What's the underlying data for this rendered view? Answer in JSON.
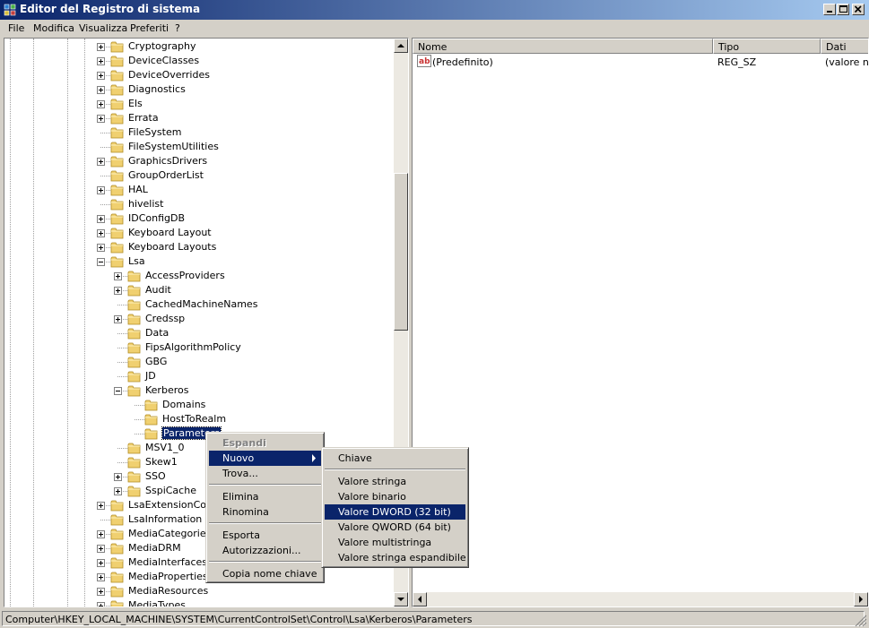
{
  "window": {
    "title": "Editor del Registro di sistema"
  },
  "menubar": {
    "items": [
      "File",
      "Modifica",
      "Visualizza",
      "Preferiti",
      "?"
    ]
  },
  "tree": {
    "items": [
      {
        "label": "Cryptography",
        "level": 0,
        "expander": "plus"
      },
      {
        "label": "DeviceClasses",
        "level": 0,
        "expander": "plus"
      },
      {
        "label": "DeviceOverrides",
        "level": 0,
        "expander": "plus"
      },
      {
        "label": "Diagnostics",
        "level": 0,
        "expander": "plus"
      },
      {
        "label": "Els",
        "level": 0,
        "expander": "plus"
      },
      {
        "label": "Errata",
        "level": 0,
        "expander": "plus"
      },
      {
        "label": "FileSystem",
        "level": 0,
        "expander": "none"
      },
      {
        "label": "FileSystemUtilities",
        "level": 0,
        "expander": "none"
      },
      {
        "label": "GraphicsDrivers",
        "level": 0,
        "expander": "plus"
      },
      {
        "label": "GroupOrderList",
        "level": 0,
        "expander": "none"
      },
      {
        "label": "HAL",
        "level": 0,
        "expander": "plus"
      },
      {
        "label": "hivelist",
        "level": 0,
        "expander": "none"
      },
      {
        "label": "IDConfigDB",
        "level": 0,
        "expander": "plus"
      },
      {
        "label": "Keyboard Layout",
        "level": 0,
        "expander": "plus"
      },
      {
        "label": "Keyboard Layouts",
        "level": 0,
        "expander": "plus"
      },
      {
        "label": "Lsa",
        "level": 0,
        "expander": "minus"
      },
      {
        "label": "AccessProviders",
        "level": 1,
        "expander": "plus"
      },
      {
        "label": "Audit",
        "level": 1,
        "expander": "plus"
      },
      {
        "label": "CachedMachineNames",
        "level": 1,
        "expander": "none"
      },
      {
        "label": "Credssp",
        "level": 1,
        "expander": "plus"
      },
      {
        "label": "Data",
        "level": 1,
        "expander": "none"
      },
      {
        "label": "FipsAlgorithmPolicy",
        "level": 1,
        "expander": "none"
      },
      {
        "label": "GBG",
        "level": 1,
        "expander": "none"
      },
      {
        "label": "JD",
        "level": 1,
        "expander": "none"
      },
      {
        "label": "Kerberos",
        "level": 1,
        "expander": "minus"
      },
      {
        "label": "Domains",
        "level": 2,
        "expander": "none"
      },
      {
        "label": "HostToRealm",
        "level": 2,
        "expander": "none"
      },
      {
        "label": "Parameters",
        "level": 2,
        "expander": "none",
        "selected": true
      },
      {
        "label": "MSV1_0",
        "level": 1,
        "expander": "none"
      },
      {
        "label": "Skew1",
        "level": 1,
        "expander": "none"
      },
      {
        "label": "SSO",
        "level": 1,
        "expander": "plus"
      },
      {
        "label": "SspiCache",
        "level": 1,
        "expander": "plus"
      },
      {
        "label": "LsaExtensionConfig",
        "level": 0,
        "expander": "plus"
      },
      {
        "label": "LsaInformation",
        "level": 0,
        "expander": "none"
      },
      {
        "label": "MediaCategories",
        "level": 0,
        "expander": "plus"
      },
      {
        "label": "MediaDRM",
        "level": 0,
        "expander": "plus"
      },
      {
        "label": "MediaInterfaces",
        "level": 0,
        "expander": "plus"
      },
      {
        "label": "MediaProperties",
        "level": 0,
        "expander": "plus"
      },
      {
        "label": "MediaResources",
        "level": 0,
        "expander": "plus"
      },
      {
        "label": "MediaTypes",
        "level": 0,
        "expander": "plus"
      }
    ]
  },
  "list": {
    "columns": [
      "Nome",
      "Tipo",
      "Dati"
    ],
    "rows": [
      {
        "name": "(Predefinito)",
        "type": "REG_SZ",
        "data": "(valore non impostato)"
      }
    ]
  },
  "context_menu": {
    "items": [
      "Espandi",
      "Nuovo",
      "Trova...",
      "Elimina",
      "Rinomina",
      "Esporta",
      "Autorizzazioni...",
      "Copia nome chiave"
    ]
  },
  "submenu": {
    "items": [
      "Chiave",
      "Valore stringa",
      "Valore binario",
      "Valore DWORD (32 bit)",
      "Valore QWORD (64 bit)",
      "Valore multistringa",
      "Valore stringa espandibile"
    ]
  },
  "statusbar": {
    "path": "Computer\\HKEY_LOCAL_MACHINE\\SYSTEM\\CurrentControlSet\\Control\\Lsa\\Kerberos\\Parameters"
  },
  "colors": {
    "titlebar_start": "#0a246a",
    "titlebar_end": "#a6caf0",
    "highlight": "#0a246a",
    "face": "#d4d0c8"
  },
  "icons": {
    "app": "registry-editor-icon",
    "folder": "folder-icon",
    "value": "string-value-icon"
  }
}
